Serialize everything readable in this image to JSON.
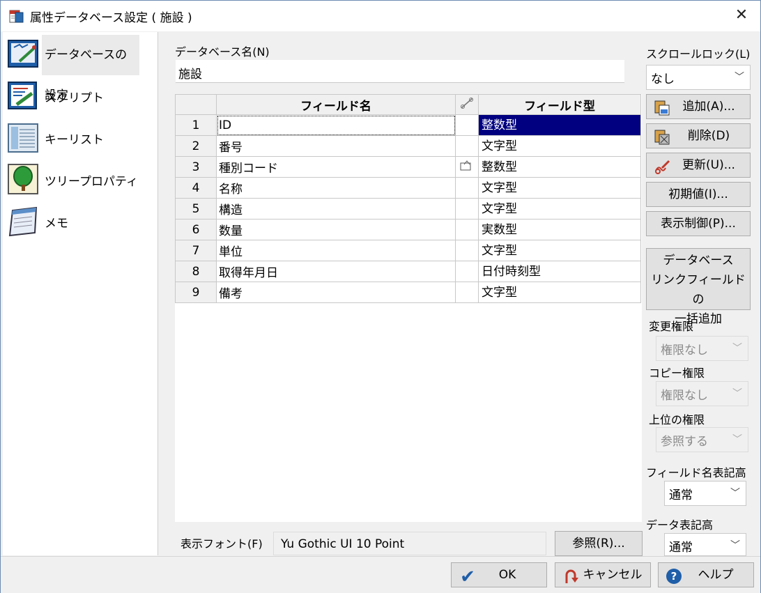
{
  "window": {
    "title": "属性データベース設定 ( 施設 )"
  },
  "nav": [
    {
      "label": "データベースの設定",
      "icon": "database-settings-icon"
    },
    {
      "label": "スクリプト",
      "icon": "script-icon"
    },
    {
      "label": "キーリスト",
      "icon": "key-list-icon"
    },
    {
      "label": "ツリープロパティ",
      "icon": "tree-icon"
    },
    {
      "label": "メモ",
      "icon": "memo-icon"
    }
  ],
  "database": {
    "name_label": "データベース名(N)",
    "name_value": "施設"
  },
  "grid": {
    "col_field_name": "フィールド名",
    "col_field_type": "フィールド型",
    "rows": [
      {
        "no": "1",
        "name": "ID",
        "type": "整数型",
        "link": false
      },
      {
        "no": "2",
        "name": "番号",
        "type": "文字型",
        "link": false
      },
      {
        "no": "3",
        "name": "種別コード",
        "type": "整数型",
        "link": true
      },
      {
        "no": "4",
        "name": "名称",
        "type": "文字型",
        "link": false
      },
      {
        "no": "5",
        "name": "構造",
        "type": "文字型",
        "link": false
      },
      {
        "no": "6",
        "name": "数量",
        "type": "実数型",
        "link": false
      },
      {
        "no": "7",
        "name": "単位",
        "type": "文字型",
        "link": false
      },
      {
        "no": "8",
        "name": "取得年月日",
        "type": "日付時刻型",
        "link": false
      },
      {
        "no": "9",
        "name": "備考",
        "type": "文字型",
        "link": false
      }
    ]
  },
  "font": {
    "label": "表示フォント(F)",
    "value": "Yu Gothic UI 10 Point",
    "browse": "参照(R)..."
  },
  "right": {
    "scroll_lock_label": "スクロールロック(L)",
    "scroll_lock_value": "なし",
    "add": "追加(A)...",
    "delete": "削除(D)",
    "update": "更新(U)...",
    "initial": "初期値(I)...",
    "display_control": "表示制御(P)...",
    "bulk_link_1": "データベース",
    "bulk_link_2": "リンクフィールドの",
    "bulk_link_3": "一括追加",
    "change_perm_label": "変更権限",
    "change_perm_value": "権限なし",
    "copy_perm_label": "コピー権限",
    "copy_perm_value": "権限なし",
    "parent_perm_label": "上位の権限",
    "parent_perm_value": "参照する",
    "field_height_label": "フィールド名表記高",
    "field_height_value": "通常",
    "data_height_label": "データ表記高",
    "data_height_value": "通常"
  },
  "footer": {
    "ok": "OK",
    "cancel": "キャンセル",
    "help": "ヘルプ"
  }
}
